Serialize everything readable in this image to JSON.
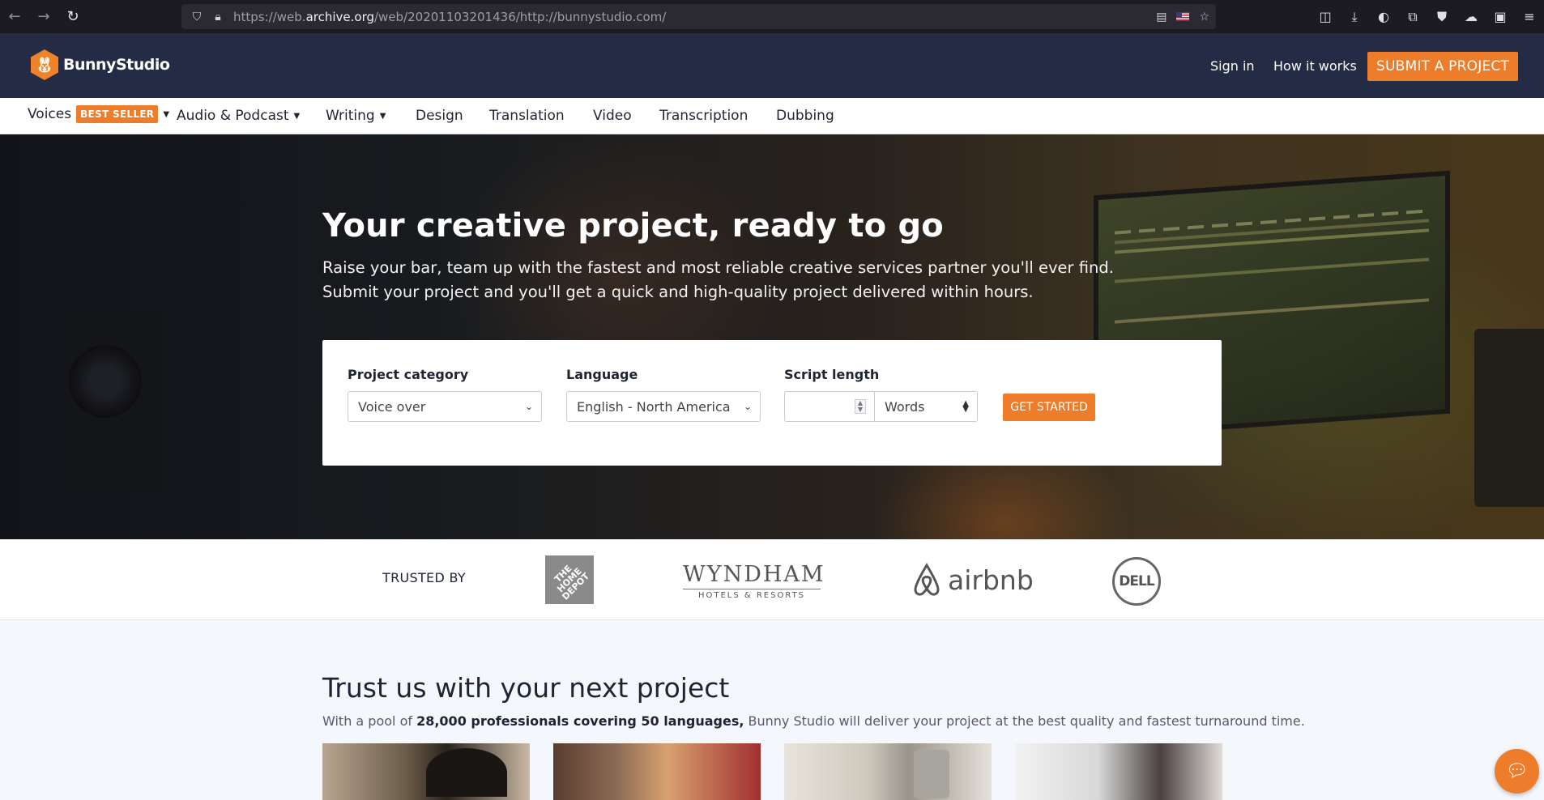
{
  "browser": {
    "url_prefix": "https://web.",
    "url_domain": "archive.org",
    "url_rest": "/web/20201103201436/http://bunnystudio.com/"
  },
  "header": {
    "logo_text": "BunnyStudio",
    "sign_in": "Sign in",
    "how_it_works": "How it works",
    "submit_project": "SUBMIT A PROJECT"
  },
  "nav": {
    "items": [
      {
        "label": "Voices",
        "badge": "BEST SELLER",
        "dropdown": true
      },
      {
        "label": "Audio & Podcast",
        "dropdown": true
      },
      {
        "label": "Writing",
        "dropdown": true
      },
      {
        "label": "Design"
      },
      {
        "label": "Translation"
      },
      {
        "label": "Video"
      },
      {
        "label": "Transcription"
      },
      {
        "label": "Dubbing"
      }
    ]
  },
  "hero": {
    "title": "Your creative project, ready to go",
    "subtitle_line1": "Raise your bar, team up with the fastest and most reliable creative services partner you'll ever find.",
    "subtitle_line2": "Submit your project and you'll get a quick and high-quality project delivered within hours."
  },
  "form": {
    "category_label": "Project category",
    "category_value": "Voice over",
    "language_label": "Language",
    "language_value": "English - North America",
    "script_label": "Script length",
    "script_value": "",
    "unit_value": "Words",
    "cta": "GET STARTED"
  },
  "trusted": {
    "label": "TRUSTED BY",
    "home_depot": "THE HOME DEPOT",
    "wyndham_main": "WYNDHAM",
    "wyndham_sub": "HOTELS & RESORTS",
    "airbnb": "airbnb",
    "dell": "DELL"
  },
  "section": {
    "title": "Trust us with your next project",
    "text_before": "With a pool of ",
    "text_bold": "28,000 professionals covering 50 languages,",
    "text_after": " Bunny Studio will deliver your project at the best quality and fastest turnaround time."
  },
  "colors": {
    "accent": "#ed7d2b",
    "header_bg": "#232b45"
  }
}
